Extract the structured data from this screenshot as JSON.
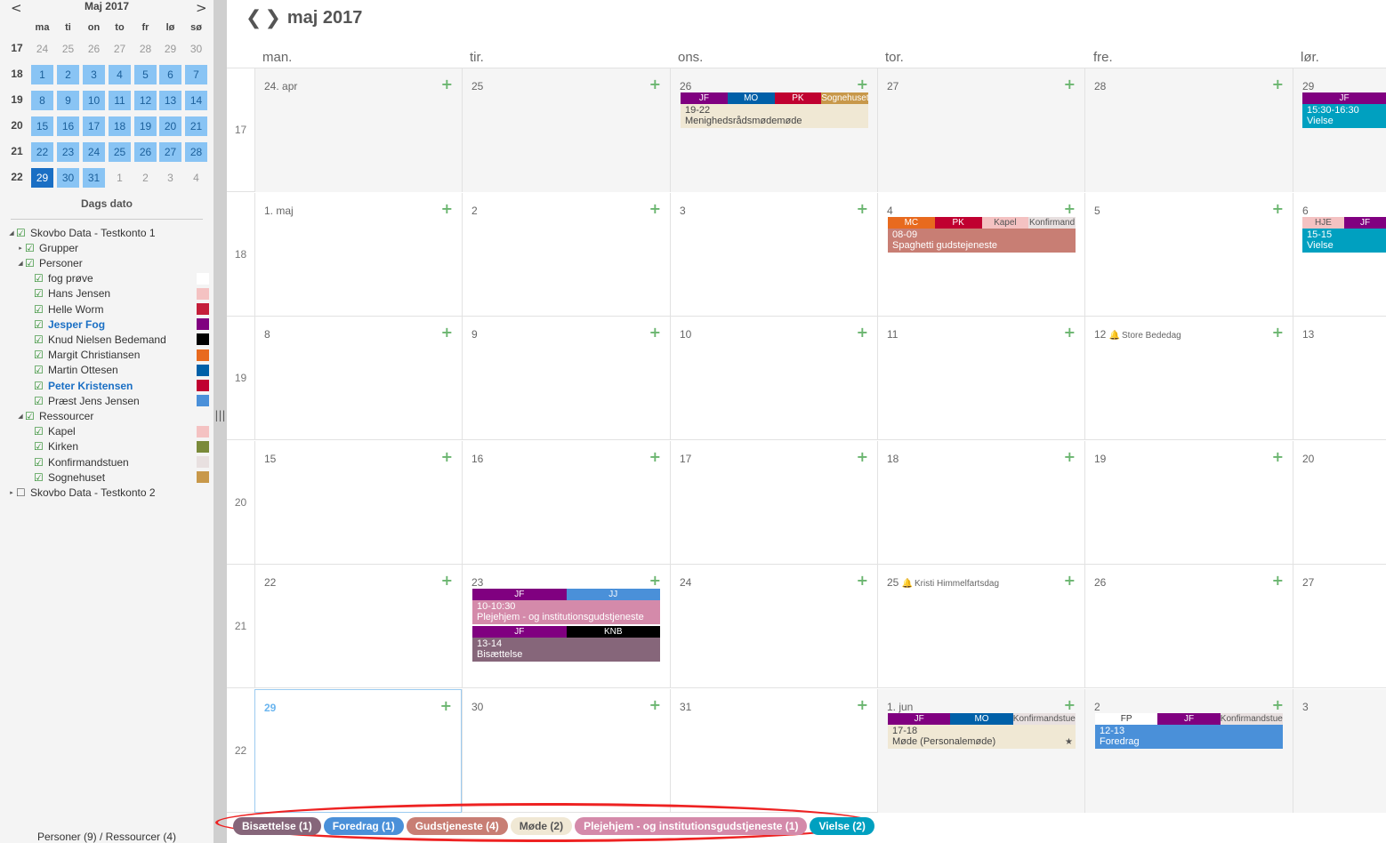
{
  "mini": {
    "title": "Maj 2017",
    "prev": "<",
    "next": ">",
    "wd": [
      "ma",
      "ti",
      "on",
      "to",
      "fr",
      "lø",
      "sø"
    ],
    "weeks": [
      {
        "w": "17",
        "days": [
          {
            "d": "24",
            "k": "out"
          },
          {
            "d": "25",
            "k": "out"
          },
          {
            "d": "26",
            "k": "out"
          },
          {
            "d": "27",
            "k": "out"
          },
          {
            "d": "28",
            "k": "out"
          },
          {
            "d": "29",
            "k": "out"
          },
          {
            "d": "30",
            "k": "out"
          }
        ]
      },
      {
        "w": "18",
        "days": [
          {
            "d": "1",
            "k": "in"
          },
          {
            "d": "2",
            "k": "in"
          },
          {
            "d": "3",
            "k": "in"
          },
          {
            "d": "4",
            "k": "in"
          },
          {
            "d": "5",
            "k": "in"
          },
          {
            "d": "6",
            "k": "in"
          },
          {
            "d": "7",
            "k": "in"
          }
        ]
      },
      {
        "w": "19",
        "days": [
          {
            "d": "8",
            "k": "in"
          },
          {
            "d": "9",
            "k": "in"
          },
          {
            "d": "10",
            "k": "in"
          },
          {
            "d": "11",
            "k": "in"
          },
          {
            "d": "12",
            "k": "in"
          },
          {
            "d": "13",
            "k": "in"
          },
          {
            "d": "14",
            "k": "in"
          }
        ]
      },
      {
        "w": "20",
        "days": [
          {
            "d": "15",
            "k": "in"
          },
          {
            "d": "16",
            "k": "in"
          },
          {
            "d": "17",
            "k": "in"
          },
          {
            "d": "18",
            "k": "in"
          },
          {
            "d": "19",
            "k": "in"
          },
          {
            "d": "20",
            "k": "in"
          },
          {
            "d": "21",
            "k": "in"
          }
        ]
      },
      {
        "w": "21",
        "days": [
          {
            "d": "22",
            "k": "in"
          },
          {
            "d": "23",
            "k": "in"
          },
          {
            "d": "24",
            "k": "in"
          },
          {
            "d": "25",
            "k": "in"
          },
          {
            "d": "26",
            "k": "in"
          },
          {
            "d": "27",
            "k": "in"
          },
          {
            "d": "28",
            "k": "in"
          }
        ]
      },
      {
        "w": "22",
        "days": [
          {
            "d": "29",
            "k": "today"
          },
          {
            "d": "30",
            "k": "in"
          },
          {
            "d": "31",
            "k": "in"
          },
          {
            "d": "1",
            "k": "out"
          },
          {
            "d": "2",
            "k": "out"
          },
          {
            "d": "3",
            "k": "out"
          },
          {
            "d": "4",
            "k": "out"
          }
        ]
      }
    ],
    "dags": "Dags dato"
  },
  "tree": [
    {
      "t": "Skovbo Data - Testkonto 1",
      "lvl": 0,
      "exp": "◢",
      "chk": true
    },
    {
      "t": "Grupper",
      "lvl": 1,
      "exp": "▸",
      "chk": true
    },
    {
      "t": "Personer",
      "lvl": 1,
      "exp": "◢",
      "chk": true
    },
    {
      "t": "fog prøve",
      "lvl": 2,
      "chk": true,
      "color": "#ffffff"
    },
    {
      "t": "Hans Jensen",
      "lvl": 2,
      "chk": true,
      "color": "#f4c2c2"
    },
    {
      "t": "Helle Worm",
      "lvl": 2,
      "chk": true,
      "color": "#c41e3a"
    },
    {
      "t": "Jesper Fog",
      "lvl": 2,
      "chk": true,
      "color": "#800080",
      "bold": true
    },
    {
      "t": "Knud Nielsen Bedemand",
      "lvl": 2,
      "chk": true,
      "color": "#000000"
    },
    {
      "t": "Margit Christiansen",
      "lvl": 2,
      "chk": true,
      "color": "#e86a1e"
    },
    {
      "t": "Martin Ottesen",
      "lvl": 2,
      "chk": true,
      "color": "#0060a8"
    },
    {
      "t": "Peter Kristensen",
      "lvl": 2,
      "chk": true,
      "color": "#c00030",
      "bold": true
    },
    {
      "t": "Præst Jens Jensen",
      "lvl": 2,
      "chk": true,
      "color": "#4a90d9"
    },
    {
      "t": "Ressourcer",
      "lvl": 1,
      "exp": "◢",
      "chk": true
    },
    {
      "t": "Kapel",
      "lvl": 2,
      "chk": true,
      "color": "#f4c2c2"
    },
    {
      "t": "Kirken",
      "lvl": 2,
      "chk": true,
      "color": "#7a8a3a"
    },
    {
      "t": "Konfirmandstuen",
      "lvl": 2,
      "chk": true,
      "color": "#e8e0e0"
    },
    {
      "t": "Sognehuset",
      "lvl": 2,
      "chk": true,
      "color": "#c8984a"
    },
    {
      "t": "Skovbo Data - Testkonto 2",
      "lvl": 0,
      "exp": "▸",
      "chk": false
    }
  ],
  "footer_left": "Personer (9) / Ressourcer (4)",
  "header": {
    "title": "maj 2017",
    "prev": "❮",
    "next": "❯",
    "days": [
      "man.",
      "tir.",
      "ons.",
      "tor.",
      "fre.",
      "lør."
    ]
  },
  "weeks": [
    {
      "w": "17",
      "days": [
        {
          "d": "24. apr",
          "dim": true
        },
        {
          "d": "25",
          "dim": true
        },
        {
          "d": "26",
          "dim": true,
          "events": [
            {
              "tags": [
                {
                  "t": "JF",
                  "c": "#800080"
                },
                {
                  "t": "MO",
                  "c": "#0060a8"
                },
                {
                  "t": "PK",
                  "c": "#c00030"
                },
                {
                  "t": "Sognehuset",
                  "c": "#c8984a"
                }
              ],
              "time": "19-22",
              "title": "Menighedsrådsmødemøde",
              "bg": "#f0e8d4",
              "fg": "#444"
            }
          ]
        },
        {
          "d": "27",
          "dim": true
        },
        {
          "d": "28",
          "dim": true
        },
        {
          "d": "29",
          "dim": true,
          "events": [
            {
              "tags": [
                {
                  "t": "JF",
                  "c": "#800080"
                }
              ],
              "time": "15:30-16:30",
              "title": "Vielse",
              "bg": "#00a0c0",
              "fg": "#fff"
            }
          ]
        }
      ]
    },
    {
      "w": "18",
      "days": [
        {
          "d": "1. maj"
        },
        {
          "d": "2"
        },
        {
          "d": "3"
        },
        {
          "d": "4",
          "events": [
            {
              "tags": [
                {
                  "t": "MC",
                  "c": "#e86a1e"
                },
                {
                  "t": "PK",
                  "c": "#c00030"
                },
                {
                  "t": "Kapel",
                  "c": "#f4c2c2",
                  "fg": "#555"
                },
                {
                  "t": "Konfirmand",
                  "c": "#e8e0e0",
                  "fg": "#555"
                }
              ],
              "time": "08-09",
              "title": "Spaghetti gudstejeneste",
              "bg": "#c87e74",
              "fg": "#fff"
            }
          ]
        },
        {
          "d": "5"
        },
        {
          "d": "6",
          "events": [
            {
              "tags": [
                {
                  "t": "HJE",
                  "c": "#f4c2c2",
                  "fg": "#555"
                },
                {
                  "t": "JF",
                  "c": "#800080"
                }
              ],
              "time": "15-15",
              "title": "Vielse",
              "bg": "#00a0c0",
              "fg": "#fff"
            }
          ]
        }
      ]
    },
    {
      "w": "19",
      "days": [
        {
          "d": "8"
        },
        {
          "d": "9"
        },
        {
          "d": "10"
        },
        {
          "d": "11"
        },
        {
          "d": "12",
          "holiday": "Store Bededag"
        },
        {
          "d": "13"
        }
      ]
    },
    {
      "w": "20",
      "days": [
        {
          "d": "15"
        },
        {
          "d": "16"
        },
        {
          "d": "17"
        },
        {
          "d": "18"
        },
        {
          "d": "19"
        },
        {
          "d": "20"
        }
      ]
    },
    {
      "w": "21",
      "days": [
        {
          "d": "22"
        },
        {
          "d": "23",
          "events": [
            {
              "tags": [
                {
                  "t": "JF",
                  "c": "#800080"
                },
                {
                  "t": "JJ",
                  "c": "#4a90d9"
                }
              ],
              "time": "10-10:30",
              "title": "Plejehjem - og institutionsgudstjeneste",
              "bg": "#d48aaa",
              "fg": "#fff"
            },
            {
              "tags": [
                {
                  "t": "JF",
                  "c": "#800080"
                },
                {
                  "t": "KNB",
                  "c": "#000000"
                }
              ],
              "time": "13-14",
              "title": "Bisættelse",
              "bg": "#86667a",
              "fg": "#fff"
            }
          ]
        },
        {
          "d": "24"
        },
        {
          "d": "25",
          "holiday": "Kristi Himmelfartsdag"
        },
        {
          "d": "26"
        },
        {
          "d": "27"
        }
      ]
    },
    {
      "w": "22",
      "days": [
        {
          "d": "29",
          "today": true
        },
        {
          "d": "30"
        },
        {
          "d": "31"
        },
        {
          "d": "1. jun",
          "dim": true,
          "events": [
            {
              "tags": [
                {
                  "t": "JF",
                  "c": "#800080"
                },
                {
                  "t": "MO",
                  "c": "#0060a8"
                },
                {
                  "t": "Konfirmandstue",
                  "c": "#e8e0e0",
                  "fg": "#555"
                }
              ],
              "time": "17-18",
              "title": "Møde (Personalemøde)",
              "bg": "#f0e8d4",
              "fg": "#444",
              "star": true
            }
          ]
        },
        {
          "d": "2",
          "dim": true,
          "events": [
            {
              "tags": [
                {
                  "t": "FP",
                  "c": "#ffffff",
                  "fg": "#333"
                },
                {
                  "t": "JF",
                  "c": "#800080"
                },
                {
                  "t": "Konfirmandstue",
                  "c": "#e8e0e0",
                  "fg": "#555"
                }
              ],
              "time": "12-13",
              "title": "Foredrag",
              "bg": "#4a90d9",
              "fg": "#fff"
            }
          ]
        },
        {
          "d": "3",
          "dim": true
        }
      ]
    }
  ],
  "legend": [
    {
      "t": "Bisættelse (1)",
      "bg": "#86667a",
      "fg": "#fff"
    },
    {
      "t": "Foredrag (1)",
      "bg": "#4a90d9",
      "fg": "#fff"
    },
    {
      "t": "Gudstjeneste (4)",
      "bg": "#c87e74",
      "fg": "#fff"
    },
    {
      "t": "Møde (2)",
      "bg": "#f0e8d4",
      "fg": "#555"
    },
    {
      "t": "Plejehjem - og institutionsgudstjeneste (1)",
      "bg": "#d48aaa",
      "fg": "#fff"
    },
    {
      "t": "Vielse (2)",
      "bg": "#00a0c0",
      "fg": "#fff"
    }
  ]
}
